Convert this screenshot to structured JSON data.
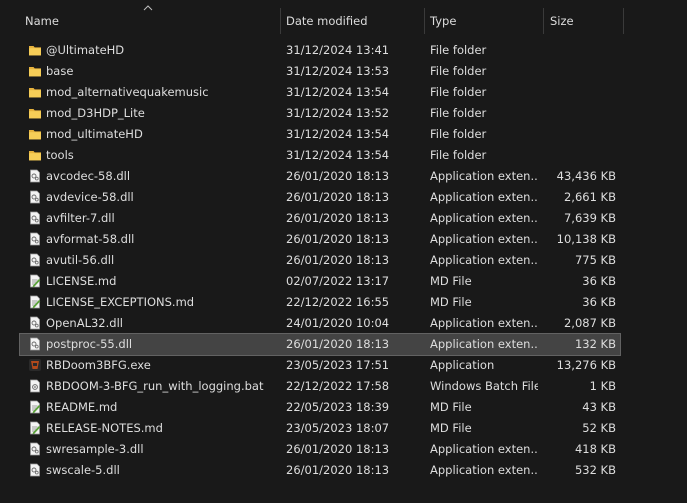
{
  "columns": {
    "name": "Name",
    "date": "Date modified",
    "type": "Type",
    "size": "Size"
  },
  "colors": {
    "background": "#191919",
    "selected_row": "#444444",
    "folder": "#f2c348"
  },
  "files": [
    {
      "name": "@UltimateHD",
      "date": "31/12/2024 13:41",
      "type": "File folder",
      "size": "",
      "icon": "folder-icon"
    },
    {
      "name": "base",
      "date": "31/12/2024 13:53",
      "type": "File folder",
      "size": "",
      "icon": "folder-icon"
    },
    {
      "name": "mod_alternativequakemusic",
      "date": "31/12/2024 13:54",
      "type": "File folder",
      "size": "",
      "icon": "folder-icon"
    },
    {
      "name": "mod_D3HDP_Lite",
      "date": "31/12/2024 13:52",
      "type": "File folder",
      "size": "",
      "icon": "folder-icon"
    },
    {
      "name": "mod_ultimateHD",
      "date": "31/12/2024 13:54",
      "type": "File folder",
      "size": "",
      "icon": "folder-icon"
    },
    {
      "name": "tools",
      "date": "31/12/2024 13:54",
      "type": "File folder",
      "size": "",
      "icon": "folder-icon"
    },
    {
      "name": "avcodec-58.dll",
      "date": "26/01/2020 18:13",
      "type": "Application exten...",
      "size": "43,436 KB",
      "icon": "dll-file-icon"
    },
    {
      "name": "avdevice-58.dll",
      "date": "26/01/2020 18:13",
      "type": "Application exten...",
      "size": "2,661 KB",
      "icon": "dll-file-icon"
    },
    {
      "name": "avfilter-7.dll",
      "date": "26/01/2020 18:13",
      "type": "Application exten...",
      "size": "7,639 KB",
      "icon": "dll-file-icon"
    },
    {
      "name": "avformat-58.dll",
      "date": "26/01/2020 18:13",
      "type": "Application exten...",
      "size": "10,138 KB",
      "icon": "dll-file-icon"
    },
    {
      "name": "avutil-56.dll",
      "date": "26/01/2020 18:13",
      "type": "Application exten...",
      "size": "775 KB",
      "icon": "dll-file-icon"
    },
    {
      "name": "LICENSE.md",
      "date": "02/07/2022 13:17",
      "type": "MD File",
      "size": "36 KB",
      "icon": "md-file-icon"
    },
    {
      "name": "LICENSE_EXCEPTIONS.md",
      "date": "22/12/2022 16:55",
      "type": "MD File",
      "size": "36 KB",
      "icon": "md-file-icon"
    },
    {
      "name": "OpenAL32.dll",
      "date": "24/01/2020 10:04",
      "type": "Application exten...",
      "size": "2,087 KB",
      "icon": "dll-file-icon"
    },
    {
      "name": "postproc-55.dll",
      "date": "26/01/2020 18:13",
      "type": "Application exten...",
      "size": "132 KB",
      "icon": "dll-file-icon",
      "selected": true
    },
    {
      "name": "RBDoom3BFG.exe",
      "date": "23/05/2023 17:51",
      "type": "Application",
      "size": "13,276 KB",
      "icon": "exe-app-icon"
    },
    {
      "name": "RBDOOM-3-BFG_run_with_logging.bat",
      "date": "22/12/2022 17:58",
      "type": "Windows Batch File",
      "size": "1 KB",
      "icon": "bat-file-icon"
    },
    {
      "name": "README.md",
      "date": "22/05/2023 18:39",
      "type": "MD File",
      "size": "43 KB",
      "icon": "md-file-icon"
    },
    {
      "name": "RELEASE-NOTES.md",
      "date": "23/05/2023 18:07",
      "type": "MD File",
      "size": "52 KB",
      "icon": "md-file-icon"
    },
    {
      "name": "swresample-3.dll",
      "date": "26/01/2020 18:13",
      "type": "Application exten...",
      "size": "418 KB",
      "icon": "dll-file-icon"
    },
    {
      "name": "swscale-5.dll",
      "date": "26/01/2020 18:13",
      "type": "Application exten...",
      "size": "532 KB",
      "icon": "dll-file-icon"
    }
  ]
}
